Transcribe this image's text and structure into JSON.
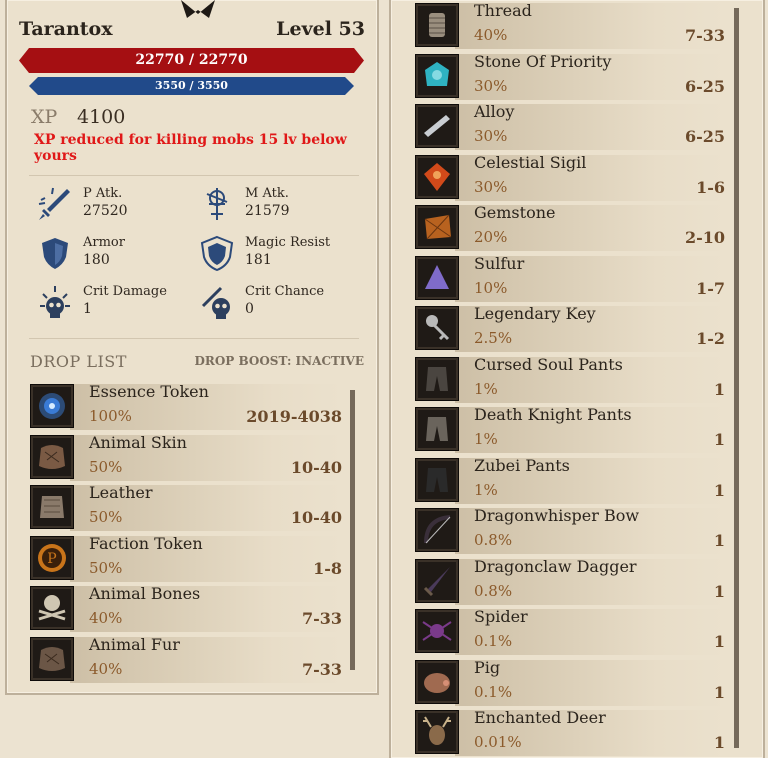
{
  "monster": {
    "name": "Tarantox",
    "level": "Level 53",
    "hp": "22770 / 22770",
    "mp": "3550 / 3550",
    "xp_label": "XP",
    "xp_value": "4100",
    "xp_warning": "XP reduced for killing mobs 15 lv  below yours"
  },
  "stats": [
    {
      "label": "P Atk.",
      "value": "27520",
      "icon": "sword-icon"
    },
    {
      "label": "M Atk.",
      "value": "21579",
      "icon": "magic-staff-icon"
    },
    {
      "label": "Armor",
      "value": "180",
      "icon": "shield-icon"
    },
    {
      "label": "Magic Resist",
      "value": "181",
      "icon": "magic-shield-icon"
    },
    {
      "label": "Crit Damage",
      "value": "1",
      "icon": "skull-burst-icon"
    },
    {
      "label": "Crit Chance",
      "value": "0",
      "icon": "skull-slash-icon"
    }
  ],
  "drop_header": {
    "title": "DROP LIST",
    "boost": "DROP BOOST: INACTIVE"
  },
  "drops_left": [
    {
      "name": "Essence Token",
      "chance": "100%",
      "qty": "2019-4038",
      "icon": "essence-token-icon",
      "color": "#3a7bd5"
    },
    {
      "name": "Animal Skin",
      "chance": "50%",
      "qty": "10-40",
      "icon": "animal-skin-icon",
      "color": "#7a5a44"
    },
    {
      "name": "Leather",
      "chance": "50%",
      "qty": "10-40",
      "icon": "leather-icon",
      "color": "#8a7a6a"
    },
    {
      "name": "Faction Token",
      "chance": "50%",
      "qty": "1-8",
      "icon": "faction-token-icon",
      "color": "#c8741a"
    },
    {
      "name": "Animal Bones",
      "chance": "40%",
      "qty": "7-33",
      "icon": "animal-bones-icon",
      "color": "#cfc6b2"
    },
    {
      "name": "Animal Fur",
      "chance": "40%",
      "qty": "7-33",
      "icon": "animal-fur-icon",
      "color": "#6b5646"
    }
  ],
  "drops_right": [
    {
      "name": "Thread",
      "chance": "40%",
      "qty": "7-33",
      "icon": "thread-icon",
      "color": "#9a8e7e"
    },
    {
      "name": "Stone Of Priority",
      "chance": "30%",
      "qty": "6-25",
      "icon": "stone-icon",
      "color": "#2fb3c2"
    },
    {
      "name": "Alloy",
      "chance": "30%",
      "qty": "6-25",
      "icon": "alloy-icon",
      "color": "#c9cdd2"
    },
    {
      "name": "Celestial Sigil",
      "chance": "30%",
      "qty": "1-6",
      "icon": "sigil-icon",
      "color": "#d24a1a"
    },
    {
      "name": "Gemstone",
      "chance": "20%",
      "qty": "2-10",
      "icon": "gemstone-icon",
      "color": "#b8621f"
    },
    {
      "name": "Sulfur",
      "chance": "10%",
      "qty": "1-7",
      "icon": "sulfur-icon",
      "color": "#7f6bc9"
    },
    {
      "name": "Legendary Key",
      "chance": "2.5%",
      "qty": "1-2",
      "icon": "key-icon",
      "color": "#b9b9b9"
    },
    {
      "name": "Cursed Soul Pants",
      "chance": "1%",
      "qty": "1",
      "icon": "pants-icon",
      "color": "#4a4540"
    },
    {
      "name": "Death Knight Pants",
      "chance": "1%",
      "qty": "1",
      "icon": "pants-icon",
      "color": "#6a645c"
    },
    {
      "name": "Zubei Pants",
      "chance": "1%",
      "qty": "1",
      "icon": "pants-icon",
      "color": "#2a2a2a"
    },
    {
      "name": "Dragonwhisper Bow",
      "chance": "0.8%",
      "qty": "1",
      "icon": "bow-icon",
      "color": "#3a2f3a"
    },
    {
      "name": "Dragonclaw Dagger",
      "chance": "0.8%",
      "qty": "1",
      "icon": "dagger-icon",
      "color": "#4a3a5a"
    },
    {
      "name": "Spider",
      "chance": "0.1%",
      "qty": "1",
      "icon": "spider-icon",
      "color": "#7a3a8a"
    },
    {
      "name": "Pig",
      "chance": "0.1%",
      "qty": "1",
      "icon": "pig-icon",
      "color": "#a06a50"
    },
    {
      "name": "Enchanted Deer",
      "chance": "0.01%",
      "qty": "1",
      "icon": "deer-icon",
      "color": "#8a6a4a"
    }
  ]
}
